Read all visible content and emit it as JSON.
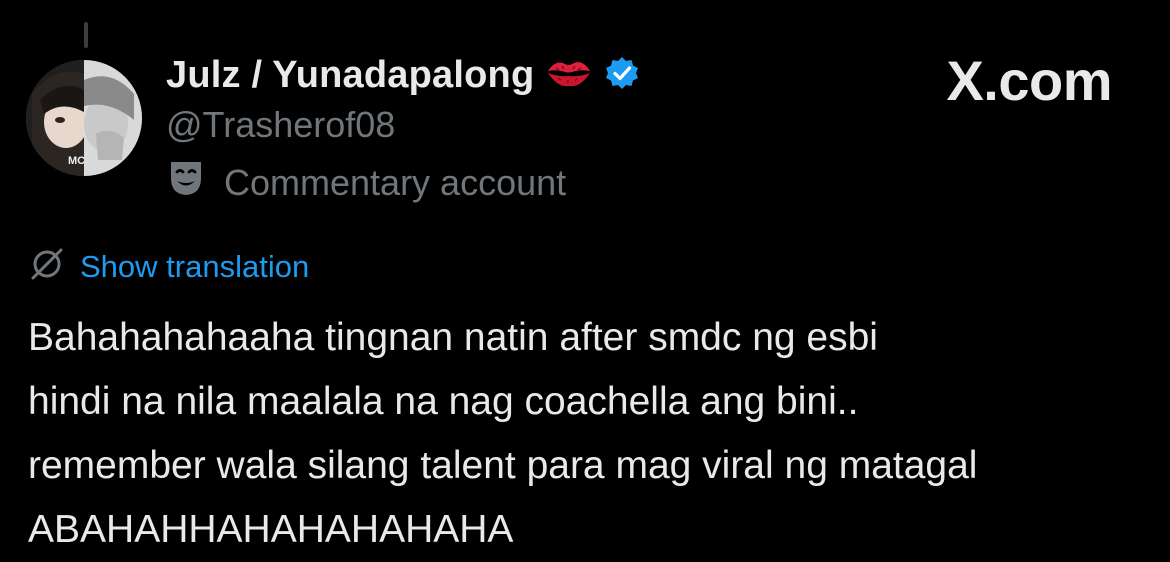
{
  "author": {
    "display_name": "Julz / Yunadapalong",
    "handle": "@Trasherof08",
    "account_label": "Commentary account",
    "emoji_icon": "kiss-mark-icon",
    "verified_icon": "verified-badge-icon",
    "label_icon": "theater-mask-icon"
  },
  "brand": {
    "text": "X.com"
  },
  "translation": {
    "link_text": "Show translation",
    "icon": "globe-slash-icon"
  },
  "tweet": {
    "lines": [
      "Bahahahahaaha tingnan natin after smdc ng esbi",
      "hindi na nila maalala na nag coachella ang bini..",
      "remember wala silang talent para mag viral ng matagal",
      "ABAHAHHAHAHAHAHAHA"
    ]
  },
  "colors": {
    "background": "#000000",
    "primary_text": "#e7e9ea",
    "secondary_text": "#71767b",
    "link": "#1d9bf0",
    "verified": "#1d9bf0",
    "kiss": "#e0203b"
  }
}
